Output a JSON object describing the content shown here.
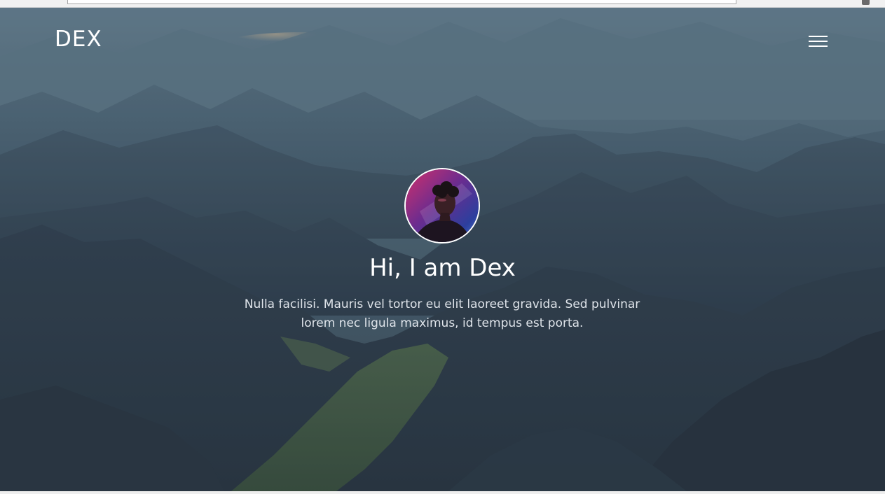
{
  "header": {
    "brand": "DEX",
    "menu_icon": "hamburger-menu-icon"
  },
  "hero": {
    "avatar_alt": "profile photo",
    "headline": "Hi, I am Dex",
    "intro": "Nulla facilisi. Mauris vel tortor eu elit laoreet gravida. Sed pulvinar lorem nec ligula maximus, id tempus est porta."
  },
  "colors": {
    "text": "#ffffff",
    "subtext": "#dfe4ea",
    "sky": "#5e7b8c",
    "valley": "#4f6a4a"
  }
}
